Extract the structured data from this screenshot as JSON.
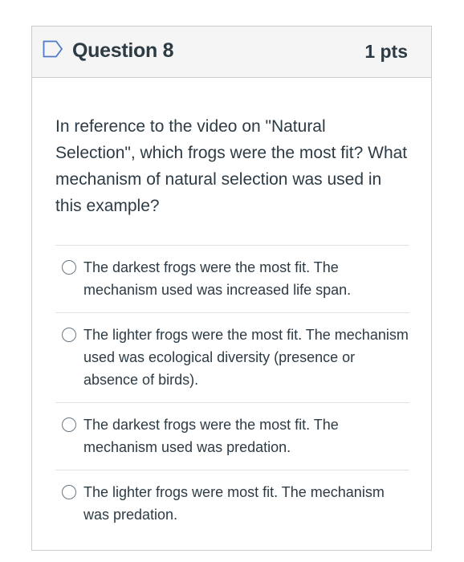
{
  "question": {
    "title": "Question 8",
    "points": "1 pts",
    "text": "In reference to the video on \"Natural Selection\", which frogs were the most fit? What mechanism of natural selection was used in this example?",
    "icon": "flag-outline-icon"
  },
  "answers": [
    {
      "label": "The darkest frogs were the most fit. The mechanism used was increased life span."
    },
    {
      "label": "The lighter frogs were the most fit. The mechanism used was ecological diversity (presence or absence of birds)."
    },
    {
      "label": "The darkest frogs were the most fit. The mechanism used was predation."
    },
    {
      "label": "The lighter frogs were most fit. The mechanism was predation."
    }
  ],
  "colors": {
    "header_bg": "#f5f5f5",
    "border": "#c7cdd1",
    "text": "#2d3b45",
    "flag_icon": "#4f7ac7"
  }
}
